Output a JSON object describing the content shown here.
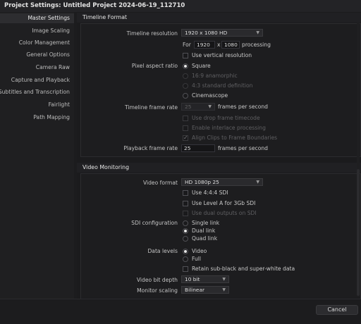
{
  "window": {
    "title": "Project Settings:  Untitled Project 2024-06-19_112710"
  },
  "sidebar": {
    "items": [
      {
        "label": "Master Settings",
        "active": true
      },
      {
        "label": "Image Scaling"
      },
      {
        "label": "Color Management"
      },
      {
        "label": "General Options"
      },
      {
        "label": "Camera Raw"
      },
      {
        "label": "Capture and Playback"
      },
      {
        "label": "Subtitles and Transcription"
      },
      {
        "label": "Fairlight"
      },
      {
        "label": "Path Mapping"
      }
    ]
  },
  "timeline_format": {
    "header": "Timeline Format",
    "resolution_label": "Timeline resolution",
    "resolution_value": "1920 x 1080 HD",
    "for_label": "For",
    "width": "1920",
    "x_label": "x",
    "height": "1080",
    "processing_label": "processing",
    "vertical_resolution": "Use vertical resolution",
    "par_label": "Pixel aspect ratio",
    "par_options": [
      "Square",
      "16:9 anamorphic",
      "4:3 standard definition",
      "Cinemascope"
    ],
    "frame_rate_label": "Timeline frame rate",
    "frame_rate_value": "25",
    "fps_label": "frames per second",
    "drop_frame": "Use drop frame timecode",
    "interlace": "Enable interlace processing",
    "align_clips": "Align Clips to Frame Boundaries",
    "playback_label": "Playback frame rate",
    "playback_value": "25",
    "playback_fps_label": "frames per second"
  },
  "video_monitoring": {
    "header": "Video Monitoring",
    "format_label": "Video format",
    "format_value": "HD 1080p 25",
    "use_444": "Use 4:4:4 SDI",
    "use_level_a": "Use Level A for 3Gb SDI",
    "dual_outputs": "Use dual outputs on SDI",
    "sdi_label": "SDI configuration",
    "sdi_options": [
      "Single link",
      "Dual link",
      "Quad link"
    ],
    "data_levels_label": "Data levels",
    "data_levels_options": [
      "Video",
      "Full"
    ],
    "retain": "Retain sub-black and super-white data",
    "bit_depth_label": "Video bit depth",
    "bit_depth_value": "10 bit",
    "scaling_label": "Monitor scaling",
    "scaling_value": "Bilinear"
  },
  "footer": {
    "cancel": "Cancel"
  }
}
